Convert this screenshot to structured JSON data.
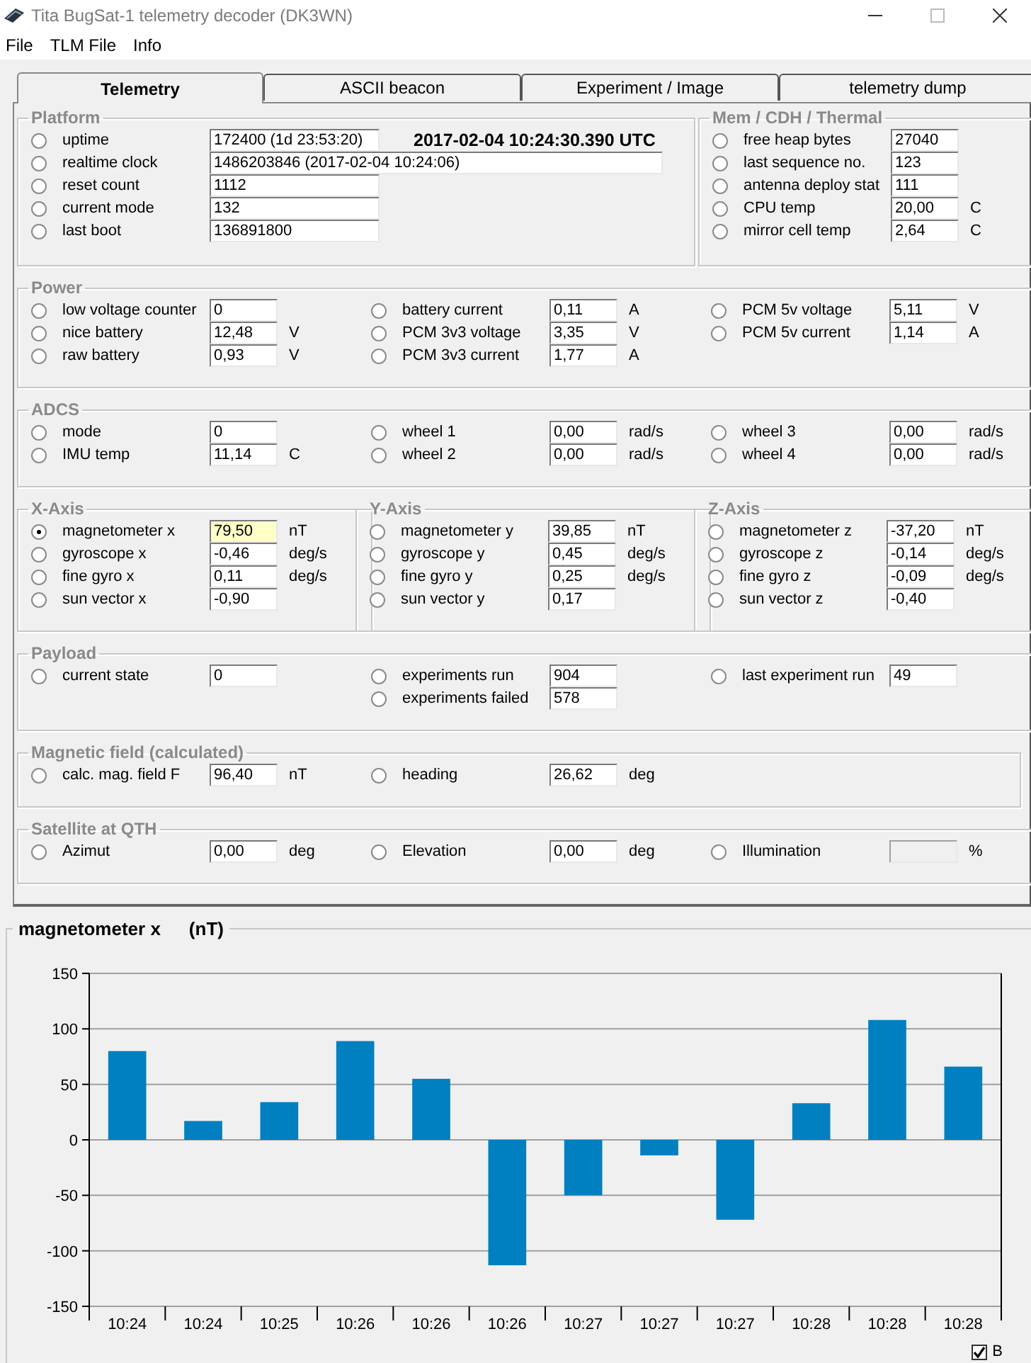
{
  "window": {
    "title": "Tita BugSat-1 telemetry decoder (DK3WN)"
  },
  "menu": [
    "File",
    "TLM File",
    "Info"
  ],
  "tabs": [
    {
      "label": "Telemetry",
      "selected": true
    },
    {
      "label": "ASCII beacon",
      "selected": false
    },
    {
      "label": "Experiment / Image",
      "selected": false
    },
    {
      "label": "telemetry dump",
      "selected": false
    }
  ],
  "panel": {
    "group_rows": [
      [
        {
          "title": "Platform",
          "kind": "wide",
          "timestamp": "2017-02-04 10:24:30.390 UTC",
          "columns": [
            [
              {
                "label": "uptime",
                "value": "172400  (1d 23:53:20)",
                "selected": false,
                "disabled": false
              },
              {
                "label": "realtime clock",
                "value": "1486203846  (2017-02-04 10:24:06)",
                "selected": false,
                "disabled": false
              },
              {
                "label": "reset count",
                "value": "1112",
                "selected": false,
                "disabled": false
              },
              {
                "label": "current mode",
                "value": "132",
                "selected": false,
                "disabled": false
              },
              {
                "label": "last boot",
                "value": "136891800",
                "selected": false,
                "disabled": false
              }
            ]
          ]
        },
        {
          "title": "Mem / CDH / Thermal",
          "kind": "compact",
          "columns": [
            [
              {
                "label": "free heap bytes",
                "value": "27040",
                "selected": false,
                "disabled": false
              },
              {
                "label": "last sequence no.",
                "value": "123",
                "selected": false,
                "disabled": false
              },
              {
                "label": "antenna deploy stat",
                "value": "111",
                "selected": false,
                "disabled": false
              },
              {
                "label": "CPU temp",
                "value": "20,00",
                "unit": "C",
                "selected": false,
                "disabled": false
              },
              {
                "label": "mirror cell temp",
                "value": "2,64",
                "unit": "C",
                "selected": false,
                "disabled": false
              }
            ]
          ]
        }
      ],
      [
        {
          "title": "Power",
          "kind": "compact",
          "columns": [
            [
              {
                "label": "low voltage counter",
                "value": "0",
                "selected": false,
                "disabled": false
              },
              {
                "label": "nice battery",
                "value": "12,48",
                "unit": "V",
                "selected": false,
                "disabled": false
              },
              {
                "label": "raw battery",
                "value": "0,93",
                "unit": "V",
                "selected": false,
                "disabled": false
              }
            ],
            [
              {
                "label": "battery current",
                "value": "0,11",
                "unit": "A",
                "selected": false,
                "disabled": false
              },
              {
                "label": "PCM 3v3 voltage",
                "value": "3,35",
                "unit": "V",
                "selected": false,
                "disabled": false
              },
              {
                "label": "PCM 3v3 current",
                "value": "1,77",
                "unit": "A",
                "selected": false,
                "disabled": false
              }
            ],
            [
              {
                "label": "PCM 5v voltage",
                "value": "5,11",
                "unit": "V",
                "selected": false,
                "disabled": false
              },
              {
                "label": "PCM 5v current",
                "value": "1,14",
                "unit": "A",
                "selected": false,
                "disabled": false
              }
            ]
          ]
        }
      ],
      [
        {
          "title": "ADCS",
          "kind": "compact",
          "columns": [
            [
              {
                "label": "mode",
                "value": "0",
                "selected": false,
                "disabled": false
              },
              {
                "label": "IMU temp",
                "value": "11,14",
                "unit": "C",
                "selected": false,
                "disabled": false
              }
            ],
            [
              {
                "label": "wheel 1",
                "value": "0,00",
                "unit": "rad/s",
                "selected": false,
                "disabled": false
              },
              {
                "label": "wheel 2",
                "value": "0,00",
                "unit": "rad/s",
                "selected": false,
                "disabled": false
              }
            ],
            [
              {
                "label": "wheel 3",
                "value": "0,00",
                "unit": "rad/s",
                "selected": false,
                "disabled": false
              },
              {
                "label": "wheel 4",
                "value": "0,00",
                "unit": "rad/s",
                "selected": false,
                "disabled": false
              }
            ]
          ]
        }
      ],
      [
        {
          "title": "X-Axis",
          "kind": "compact",
          "columns": [
            [
              {
                "label": "magnetometer x",
                "value": "79,50",
                "unit": "nT",
                "selected": true,
                "disabled": false
              },
              {
                "label": "gyroscope x",
                "value": "-0,46",
                "unit": "deg/s",
                "selected": false,
                "disabled": false
              },
              {
                "label": "fine gyro x",
                "value": "0,11",
                "unit": "deg/s",
                "selected": false,
                "disabled": false
              },
              {
                "label": "sun vector x",
                "value": "-0,90",
                "selected": false,
                "disabled": false
              }
            ]
          ]
        },
        {
          "title": "Y-Axis",
          "kind": "compact",
          "columns": [
            [
              {
                "label": "magnetometer y",
                "value": "39,85",
                "unit": "nT",
                "selected": false,
                "disabled": false
              },
              {
                "label": "gyroscope y",
                "value": "0,45",
                "unit": "deg/s",
                "selected": false,
                "disabled": false
              },
              {
                "label": "fine gyro y",
                "value": "0,25",
                "unit": "deg/s",
                "selected": false,
                "disabled": false
              },
              {
                "label": "sun vector y",
                "value": "0,17",
                "selected": false,
                "disabled": false
              }
            ]
          ]
        },
        {
          "title": "Z-Axis",
          "kind": "compact",
          "columns": [
            [
              {
                "label": "magnetometer z",
                "value": "-37,20",
                "unit": "nT",
                "selected": false,
                "disabled": false
              },
              {
                "label": "gyroscope z",
                "value": "-0,14",
                "unit": "deg/s",
                "selected": false,
                "disabled": false
              },
              {
                "label": "fine gyro z",
                "value": "-0,09",
                "unit": "deg/s",
                "selected": false,
                "disabled": false
              },
              {
                "label": "sun vector z",
                "value": "-0,40",
                "selected": false,
                "disabled": false
              }
            ]
          ]
        }
      ],
      [
        {
          "title": "Payload",
          "kind": "compact",
          "columns": [
            [
              {
                "label": "current state",
                "value": "0",
                "selected": false,
                "disabled": false
              }
            ],
            [
              {
                "label": "experiments run",
                "value": "904",
                "selected": false,
                "disabled": false
              },
              {
                "label": "experiments failed",
                "value": "578",
                "selected": false,
                "disabled": false
              }
            ],
            [
              {
                "label": "last experiment run",
                "value": "49",
                "selected": false,
                "disabled": false
              }
            ]
          ]
        }
      ],
      [
        {
          "title": "Magnetic field (calculated)",
          "kind": "compact",
          "columns": [
            [
              {
                "label": "calc. mag. field F",
                "value": "96,40",
                "unit": "nT",
                "selected": false,
                "disabled": false
              }
            ],
            [
              {
                "label": "heading",
                "value": "26,62",
                "unit": "deg",
                "selected": false,
                "disabled": false
              }
            ]
          ]
        }
      ],
      [
        {
          "title": "Satellite at QTH",
          "kind": "compact",
          "columns": [
            [
              {
                "label": "Azimut",
                "value": "0,00",
                "unit": "deg",
                "selected": false,
                "disabled": false
              }
            ],
            [
              {
                "label": "Elevation",
                "value": "0,00",
                "unit": "deg",
                "selected": false,
                "disabled": false
              }
            ],
            [
              {
                "label": "Illumination",
                "unit": "%",
                "selected": false,
                "disabled": true
              }
            ]
          ]
        }
      ]
    ]
  },
  "chart_panel": {
    "title": "magnetometer x",
    "unit": "(nT)",
    "legend": {
      "checked": true
    },
    "chart_data": {
      "type": "bar",
      "categories": [
        "10:24",
        "10:24",
        "10:25",
        "10:26",
        "10:26",
        "10:26",
        "10:27",
        "10:27",
        "10:27",
        "10:28",
        "10:28",
        "10:28"
      ],
      "series": [
        {
          "name": "B",
          "color": "#0080c0",
          "values": [
            80,
            17,
            34,
            89,
            55,
            -113,
            -50,
            -14,
            -72,
            33,
            108,
            66
          ]
        }
      ],
      "grid": true,
      "ylim": [
        -150,
        150
      ],
      "yticks": [
        -150,
        -100,
        -50,
        0,
        50,
        100,
        150
      ]
    }
  }
}
